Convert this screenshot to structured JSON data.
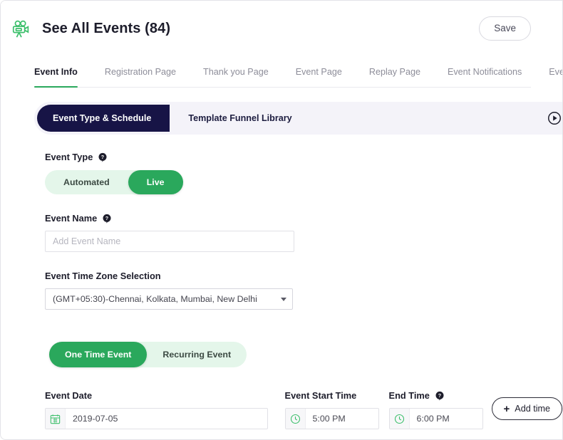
{
  "header": {
    "icon": "video-camera-icon",
    "title": "See All Events (84)",
    "save_label": "Save",
    "accent_green": "#2aa85c",
    "navy": "#171446"
  },
  "tabs": [
    {
      "label": "Event Info",
      "active": true
    },
    {
      "label": "Registration Page",
      "active": false
    },
    {
      "label": "Thank you Page",
      "active": false
    },
    {
      "label": "Event Page",
      "active": false
    },
    {
      "label": "Replay Page",
      "active": false
    },
    {
      "label": "Event Notifications",
      "active": false
    },
    {
      "label": "Event Integration",
      "active": false
    }
  ],
  "subtabs": {
    "items": [
      {
        "label": "Event Type & Schedule",
        "active": true
      },
      {
        "label": "Template Funnel Library",
        "active": false
      }
    ],
    "play_icon": "play-circle-icon"
  },
  "form": {
    "event_type": {
      "label": "Event Type",
      "help_icon": "help-question-icon",
      "options": [
        {
          "label": "Automated",
          "active": false
        },
        {
          "label": "Live",
          "active": true
        }
      ]
    },
    "event_name": {
      "label": "Event Name",
      "help_icon": "help-question-icon",
      "value": "",
      "placeholder": "Add Event Name"
    },
    "timezone": {
      "label": "Event Time Zone Selection",
      "value": "(GMT+05:30)-Chennai, Kolkata, Mumbai, New Delhi",
      "caret_icon": "chevron-down-icon"
    },
    "recurrence": {
      "options": [
        {
          "label": "One Time Event",
          "active": true
        },
        {
          "label": "Recurring Event",
          "active": false
        }
      ]
    },
    "event_date": {
      "label": "Event Date",
      "icon": "calendar-icon",
      "value": "2019-07-05"
    },
    "start_time": {
      "label": "Event Start Time",
      "icon": "clock-icon",
      "value": "5:00 PM"
    },
    "end_time": {
      "label": "End Time",
      "help_icon": "help-question-icon",
      "icon": "clock-icon",
      "value": "6:00 PM"
    },
    "add_time": {
      "label": "Add time",
      "plus": "+"
    }
  }
}
